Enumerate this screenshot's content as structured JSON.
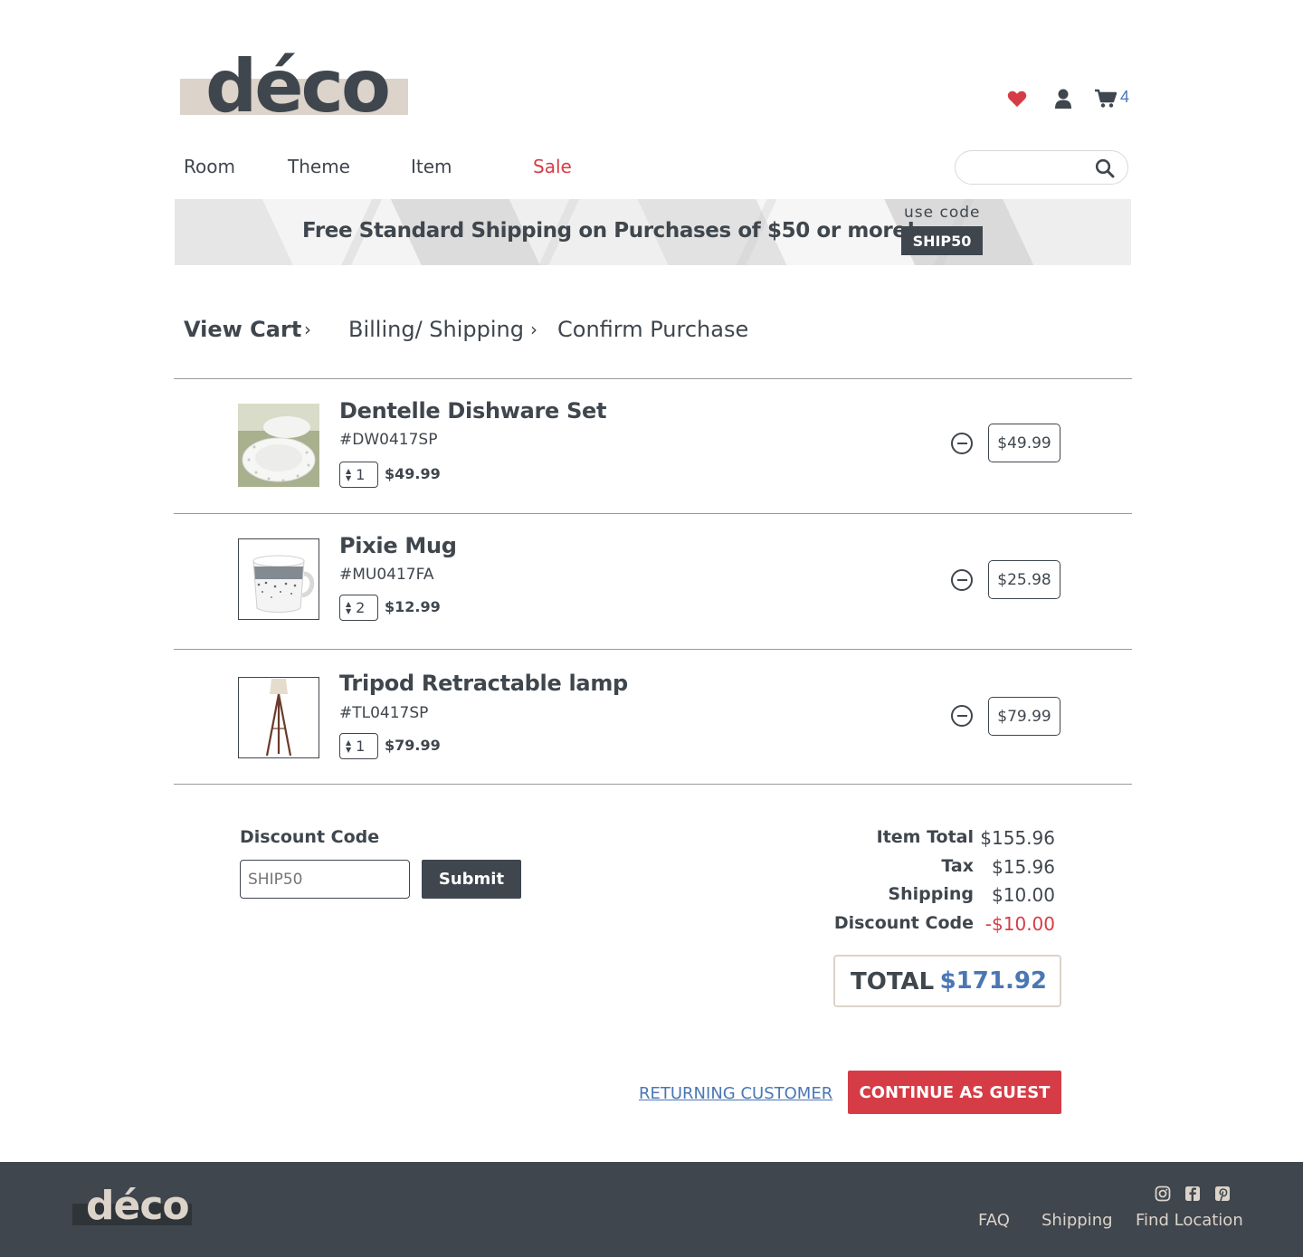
{
  "brand": {
    "logo_text": "déco",
    "logo_bar_color": "#dcd3ca"
  },
  "header": {
    "icons": [
      "heart-icon",
      "user-icon",
      "cart-icon"
    ],
    "cart_count": "4",
    "accent_red": "#d63c46",
    "accent_blue": "#4a77b4"
  },
  "nav": {
    "items": [
      {
        "label": "Room"
      },
      {
        "label": "Theme"
      },
      {
        "label": "Item"
      },
      {
        "label": "Sale"
      }
    ],
    "search_placeholder": ""
  },
  "banner": {
    "message": "Free Standard Shipping on Purchases of $50 or more!",
    "use_code_label": "use code",
    "code": "SHIP50"
  },
  "breadcrumb": {
    "steps": [
      {
        "label": "View Cart",
        "active": true
      },
      {
        "label": "Billing/ Shipping",
        "active": false
      },
      {
        "label": "Confirm Purchase",
        "active": false
      }
    ],
    "separator": "›"
  },
  "cart": {
    "items": [
      {
        "name": "Dentelle Dishware Set",
        "sku": "#DW0417SP",
        "qty": "1",
        "unit_price": "$49.99",
        "line_total": "$49.99",
        "image": "dishware-image"
      },
      {
        "name": "Pixie Mug",
        "sku": "#MU0417FA",
        "qty": "2",
        "unit_price": "$12.99",
        "line_total": "$25.98",
        "image": "mug-image"
      },
      {
        "name": "Tripod Retractable lamp",
        "sku": "#TL0417SP",
        "qty": "1",
        "unit_price": "$79.99",
        "line_total": "$79.99",
        "image": "lamp-image"
      }
    ]
  },
  "discount": {
    "label": "Discount Code",
    "value": "SHIP50",
    "submit_label": "Submit"
  },
  "summary": {
    "rows": [
      {
        "label": "Item Total",
        "value": "$155.96"
      },
      {
        "label": "Tax",
        "value": "$15.96"
      },
      {
        "label": "Shipping",
        "value": "$10.00"
      },
      {
        "label": "Discount Code",
        "value": "-$10.00"
      }
    ],
    "total_label": "TOTAL",
    "total_value": "$171.92"
  },
  "actions": {
    "returning_label": "RETURNING CUSTOMER",
    "guest_label": "CONTINUE AS GUEST"
  },
  "footer": {
    "logo_text": "déco",
    "social_icons": [
      "instagram-icon",
      "facebook-icon",
      "pinterest-icon"
    ],
    "links": [
      {
        "label": "FAQ"
      },
      {
        "label": "Shipping"
      },
      {
        "label": "Find Location"
      }
    ]
  }
}
